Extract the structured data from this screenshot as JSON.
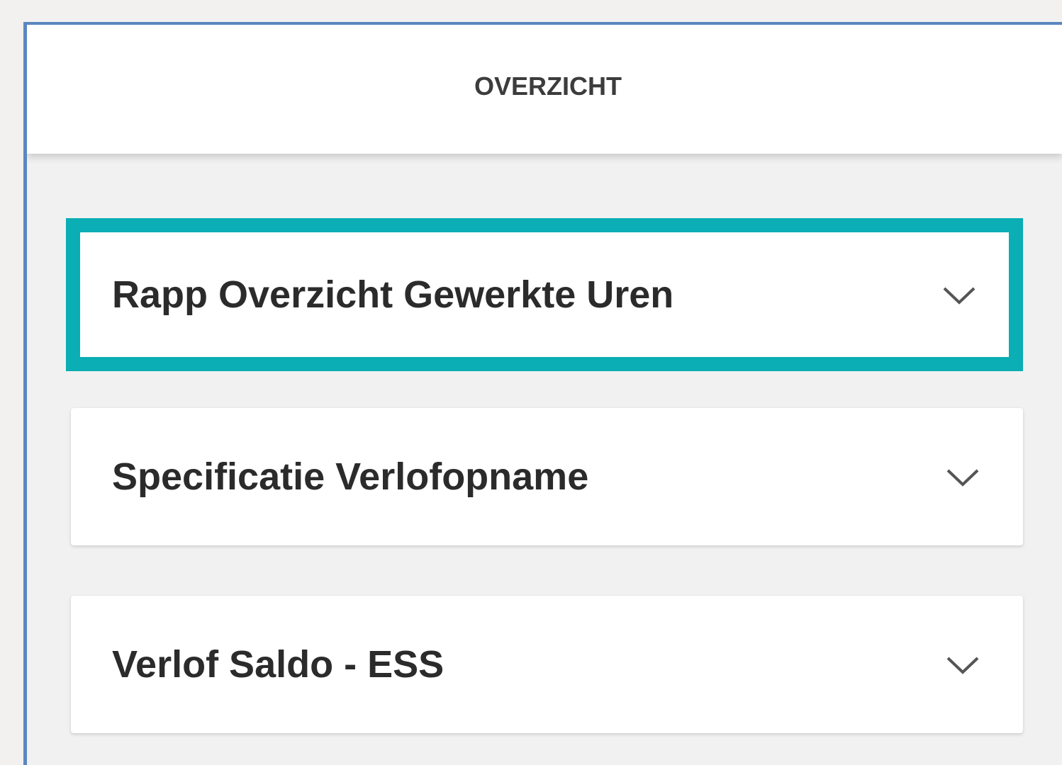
{
  "header": {
    "title": "OVERZICHT"
  },
  "sections": [
    {
      "label": "Rapp Overzicht Gewerkte Uren",
      "icon": "chevron-down-icon",
      "highlighted": true
    },
    {
      "label": "Specificatie Verlofopname",
      "icon": "chevron-down-icon",
      "highlighted": false
    },
    {
      "label": "Verlof Saldo - ESS",
      "icon": "chevron-down-icon",
      "highlighted": false
    }
  ],
  "colors": {
    "highlight": "#0aaeb4",
    "frame_border": "#5a87c0",
    "background": "#f1f1f1",
    "card": "#ffffff",
    "text": "#2b2b2b"
  }
}
